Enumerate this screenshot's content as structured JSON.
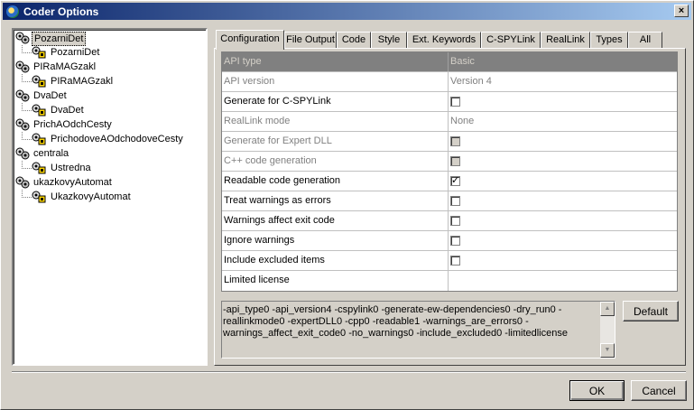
{
  "window": {
    "title": "Coder Options",
    "close_label": "×"
  },
  "tree": [
    {
      "label": "PozarniDet",
      "children": [
        "PozarniDet"
      ]
    },
    {
      "label": "PIRaMAGzakl",
      "children": [
        "PIRaMAGzakl"
      ]
    },
    {
      "label": "DvaDet",
      "children": [
        "DvaDet"
      ]
    },
    {
      "label": "PrichAOdchCesty",
      "children": [
        "PrichodoveAOdchodoveCesty"
      ]
    },
    {
      "label": "centrala",
      "children": [
        "Ustredna"
      ]
    },
    {
      "label": "ukazkovyAutomat",
      "children": [
        "UkazkovyAutomat"
      ]
    }
  ],
  "tabs": [
    "Configuration",
    "File Output",
    "Code",
    "Style",
    "Ext. Keywords",
    "C-SPYLink",
    "RealLink",
    "Types",
    "All"
  ],
  "active_tab": "Configuration",
  "grid": {
    "rows": [
      {
        "name": "API type",
        "value": "Basic",
        "kind": "header"
      },
      {
        "name": "API version",
        "value": "Version 4",
        "kind": "text",
        "disabled": true
      },
      {
        "name": "Generate for C-SPYLink",
        "kind": "check",
        "checked": false,
        "disabled": false
      },
      {
        "name": "RealLink mode",
        "value": "None",
        "kind": "text",
        "disabled": true
      },
      {
        "name": "Generate for Expert DLL",
        "kind": "check",
        "checked": false,
        "disabled": true
      },
      {
        "name": "C++ code generation",
        "kind": "check",
        "checked": false,
        "disabled": true
      },
      {
        "name": "Readable code generation",
        "kind": "check",
        "checked": true,
        "disabled": false
      },
      {
        "name": "Treat warnings as errors",
        "kind": "check",
        "checked": false,
        "disabled": false
      },
      {
        "name": "Warnings affect exit code",
        "kind": "check",
        "checked": false,
        "disabled": false
      },
      {
        "name": "Ignore warnings",
        "kind": "check",
        "checked": false,
        "disabled": false
      },
      {
        "name": "Include excluded items",
        "kind": "check",
        "checked": false,
        "disabled": false
      },
      {
        "name": "Limited license",
        "value": "",
        "kind": "text",
        "disabled": false
      }
    ]
  },
  "command_line": "-api_type0 -api_version4 -cspylink0 -generate-ew-dependencies0 -dry_run0 -reallinkmode0 -expertDLL0 -cpp0 -readable1 -warnings_are_errors0 -warnings_affect_exit_code0 -no_warnings0 -include_excluded0 -limitedlicense",
  "buttons": {
    "default": "Default",
    "ok": "OK",
    "cancel": "Cancel"
  },
  "icons": {
    "tree_node": "gears-icon",
    "tree_child": "state-machine-icon",
    "scroll_up": "arrow-up-icon",
    "scroll_down": "arrow-down-icon"
  }
}
